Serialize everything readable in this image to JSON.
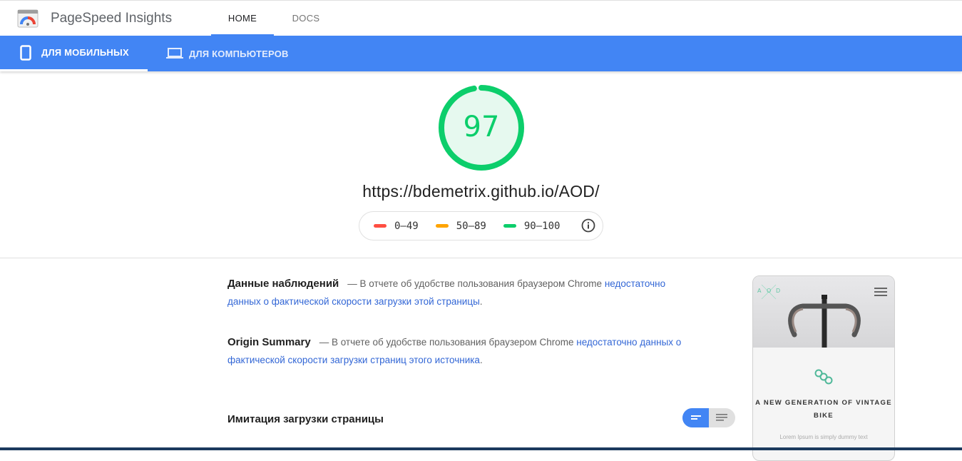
{
  "app": {
    "title": "PageSpeed Insights"
  },
  "nav": {
    "home": "HOME",
    "docs": "DOCS"
  },
  "device_tabs": {
    "mobile": "ДЛЯ МОБИЛЬНЫХ",
    "desktop": "ДЛЯ КОМПЬЮТЕРОВ"
  },
  "score": {
    "value": "97",
    "fraction": 0.97,
    "color": "#0cce6b"
  },
  "url": "https://bdemetrix.github.io/AOD/",
  "legend": [
    {
      "label": "0–49",
      "color": "#ff4e42"
    },
    {
      "label": "50–89",
      "color": "#ffa400"
    },
    {
      "label": "90–100",
      "color": "#0cce6b"
    }
  ],
  "field_data": {
    "title": "Данные наблюдений",
    "text": "— В отчете об удобстве пользования браузером Chrome",
    "link": "недостаточно данных о фактической скорости загрузки этой страницы",
    "end": "."
  },
  "origin_summary": {
    "title": "Origin Summary",
    "text": "— В отчете об удобстве пользования браузером Chrome",
    "link": "недостаточно данных о фактической скорости загрузки страниц этого источника",
    "end": "."
  },
  "lab": {
    "title": "Имитация загрузки страницы"
  },
  "preview": {
    "logo_letters": [
      "A",
      "O",
      "D"
    ],
    "headline": "A NEW GENERATION OF VINTAGE BIKE",
    "lorem": "Lorem Ipsum is simply dummy text"
  },
  "colors": {
    "accent": "#4285f4",
    "link": "#3367d6"
  }
}
